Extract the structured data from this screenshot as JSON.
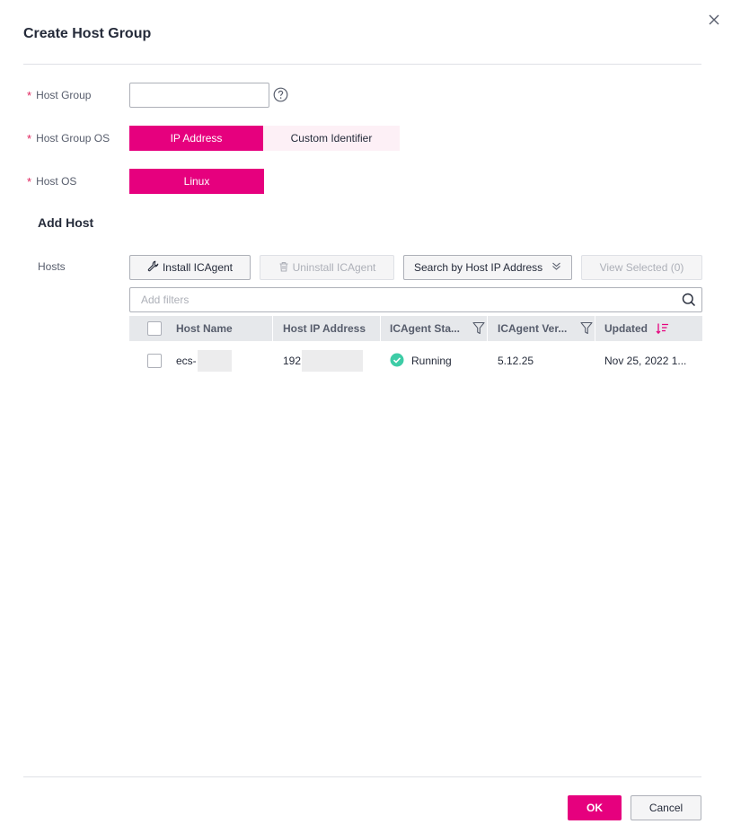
{
  "dialog": {
    "title": "Create Host Group"
  },
  "form": {
    "host_group_label": "Host Group",
    "host_group_value": "",
    "host_group_os_label": "Host Group OS",
    "host_group_os_options": [
      "IP Address",
      "Custom Identifier"
    ],
    "host_group_os_selected": "IP Address",
    "host_os_label": "Host OS",
    "host_os_options": [
      "Linux"
    ],
    "host_os_selected": "Linux",
    "required_mark": "*"
  },
  "add_host": {
    "section_title": "Add Host",
    "hosts_label": "Hosts",
    "install_btn": "Install ICAgent",
    "uninstall_btn": "Uninstall ICAgent",
    "search_mode": "Search by Host IP Address",
    "view_selected_btn": "View Selected (0)",
    "filter_placeholder": "Add filters"
  },
  "table": {
    "columns": [
      "Host Name",
      "Host IP Address",
      "ICAgent Sta...",
      "ICAgent Ver...",
      "Updated"
    ],
    "rows": [
      {
        "host_name": "ecs-",
        "host_ip": "192",
        "icagent_status": "Running",
        "icagent_version": "5.12.25",
        "updated": "Nov 25, 2022 1..."
      }
    ]
  },
  "footer": {
    "ok": "OK",
    "cancel": "Cancel"
  },
  "colors": {
    "accent": "#e6007e",
    "accent_light": "#fdf0f6",
    "success": "#3dcca6",
    "required": "#e0245e"
  },
  "icons": [
    "close-icon",
    "help-icon",
    "wrench-icon",
    "trash-icon",
    "chevron-double-down-icon",
    "search-icon",
    "filter-icon",
    "sort-desc-icon",
    "check-circle-icon"
  ]
}
